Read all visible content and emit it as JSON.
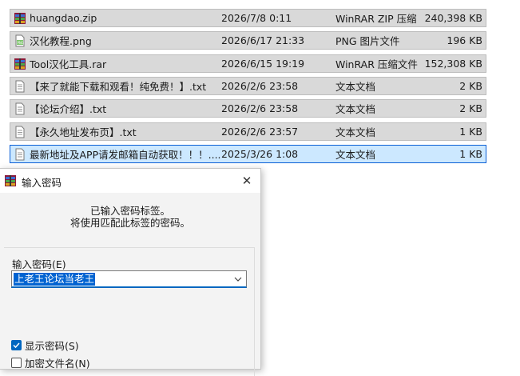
{
  "files": [
    {
      "name": "huangdao.zip",
      "date": "2026/7/8 0:11",
      "type": "WinRAR ZIP 压缩",
      "size": "240,398 KB",
      "icon": "winrar-archive-icon",
      "selected": false
    },
    {
      "name": "汉化教程.png",
      "date": "2026/6/17 21:33",
      "type": "PNG 图片文件",
      "size": "196 KB",
      "icon": "png-image-icon",
      "selected": false
    },
    {
      "name": "Tool汉化工具.rar",
      "date": "2026/6/15 19:19",
      "type": "WinRAR 压缩文件",
      "size": "152,308 KB",
      "icon": "winrar-archive-icon",
      "selected": false
    },
    {
      "name": "【来了就能下载和观看！纯免费！】.txt",
      "date": "2026/2/6 23:58",
      "type": "文本文档",
      "size": "2 KB",
      "icon": "text-file-icon",
      "selected": false
    },
    {
      "name": "【论坛介绍】.txt",
      "date": "2026/2/6 23:58",
      "type": "文本文档",
      "size": "2 KB",
      "icon": "text-file-icon",
      "selected": false
    },
    {
      "name": "【永久地址发布页】.txt",
      "date": "2026/2/6 23:57",
      "type": "文本文档",
      "size": "1 KB",
      "icon": "text-file-icon",
      "selected": false
    },
    {
      "name": "最新地址及APP请发邮箱自动获取！！！....",
      "date": "2025/3/26 1:08",
      "type": "文本文档",
      "size": "1 KB",
      "icon": "text-file-icon",
      "selected": true
    }
  ],
  "dialog": {
    "title": "输入密码",
    "close": "✕",
    "message_line1": "已输入密码标签。",
    "message_line2": "将使用匹配此标签的密码。",
    "password_label": "输入密码(E)",
    "password_value": "上老王论坛当老王",
    "show_password_label": "显示密码(S)",
    "show_password_checked": true,
    "encrypt_filenames_label": "加密文件名(N)",
    "encrypt_filenames_checked": false
  },
  "colors": {
    "row_bg": "#d9d9d9",
    "selected_row_bg": "#cce8ff",
    "selected_border": "#0a5fd6",
    "accent": "#0067c0"
  }
}
